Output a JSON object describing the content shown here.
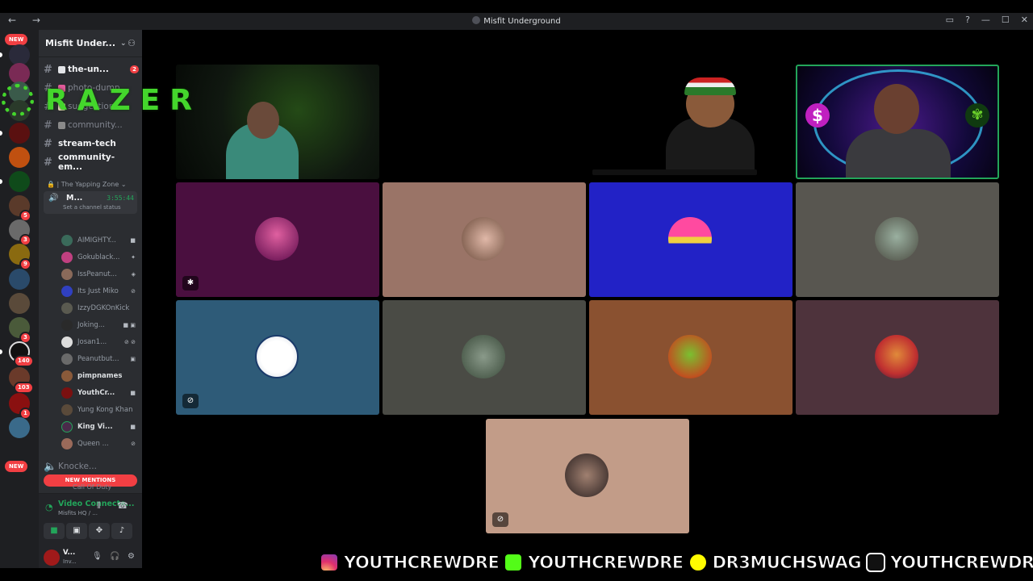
{
  "window": {
    "title": "Misfit Underground",
    "nav": "←  →",
    "controls": [
      "▭",
      "?",
      "—",
      "☐",
      "✕"
    ]
  },
  "server_rail": {
    "new_top": "NEW",
    "new_bottom": "NEW",
    "badges": [
      "5",
      "3",
      "9",
      "3",
      "140",
      "103",
      "1"
    ]
  },
  "sidebar": {
    "server_name": "Misfit Under...",
    "channels": [
      {
        "label": "the-un...",
        "badge": "2",
        "unread": true
      },
      {
        "label": "photo-dump",
        "unread": false
      },
      {
        "label": "suggestions",
        "unread": false
      },
      {
        "label": "community...",
        "unread": false
      },
      {
        "label": "stream-tech",
        "unread": true
      },
      {
        "label": "community-em...",
        "unread": true
      }
    ],
    "category": "The Yapping Zone",
    "voice_channel": {
      "name": "M...",
      "time": "3:55:44",
      "status": "Set a channel status"
    },
    "voice_users": [
      "AIMIGHTY...",
      "Gokublack...",
      "IssPeanut...",
      "Its Just Miko",
      "IzzyDGKOnKick",
      "Joking...",
      "Josan1...",
      "Peanutbut...",
      "pimpnames",
      "YouthCr...",
      "Yung Kong Khan",
      "King Vi...",
      "Queen ..."
    ],
    "other_channel": "Knocke...",
    "other_channel_2": "Call Of Duty",
    "new_mentions": "NEW MENTIONS"
  },
  "connection": {
    "status": "Video Connecte...",
    "location": "Misfits HQ / ...",
    "buttons": [
      "camera",
      "screen-share",
      "activities",
      "soundboard"
    ]
  },
  "user": {
    "name": "V...",
    "status": "Inv..."
  },
  "overlay": {
    "brand": "RAZER",
    "socials": [
      "YOUTHCREWDRE",
      "YOUTHCREWDRE",
      "DR3MUCHSWAG",
      "YOUTHCREWDRE"
    ]
  },
  "colors": {
    "tile_bg": [
      "#4a0f3f",
      "#9a7467",
      "#2222c6",
      "#585650",
      "#2e5b78",
      "#4a4b45",
      "#8a5130",
      "#4e333c",
      "#c29c88"
    ],
    "accent_green": "#23a55a",
    "danger_red": "#f23f43"
  }
}
